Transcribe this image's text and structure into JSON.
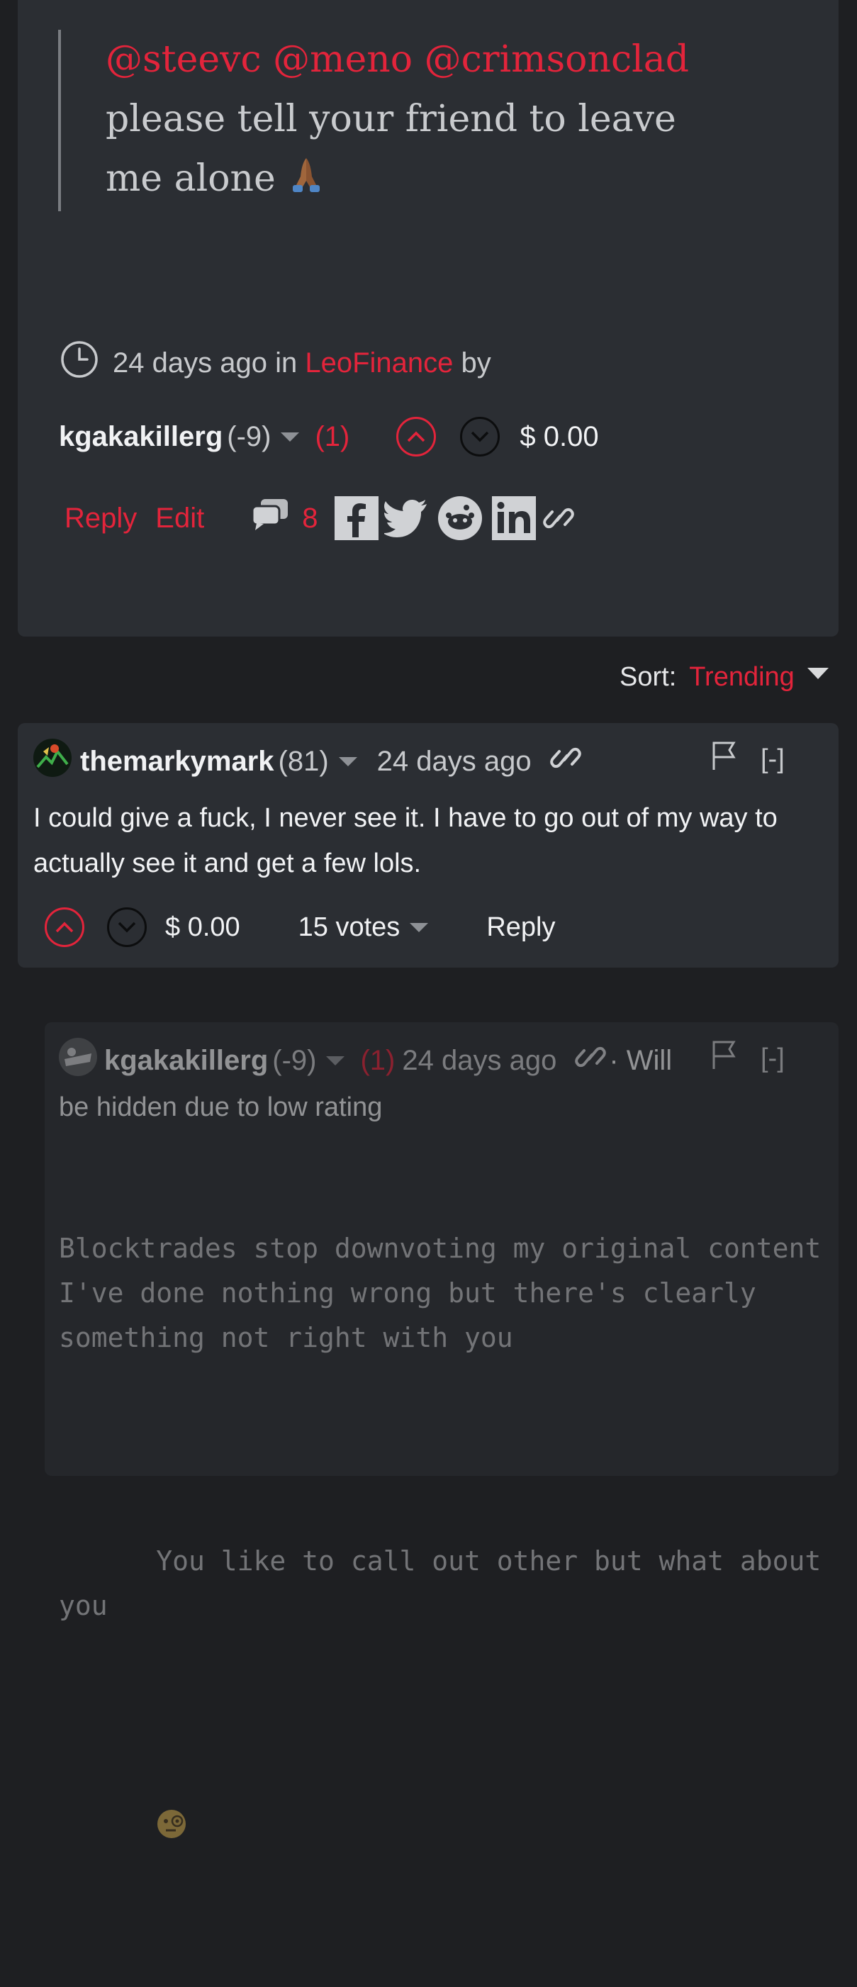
{
  "post": {
    "mentions": "@steevc @meno @crimsonclad",
    "body_text": "please tell your friend to leave me alone",
    "body_emoji": "🙏🏾",
    "meta_time": "24 days ago",
    "meta_in": "in",
    "community": "LeoFinance",
    "meta_by": "by",
    "author": "kgakakillerg",
    "author_rep": "(-9)",
    "flag_count": "(1)",
    "payout": "$ 0.00",
    "reply_label": "Reply",
    "edit_label": "Edit",
    "comments_count": "8",
    "share_icons": [
      "facebook-icon",
      "twitter-icon",
      "reddit-icon",
      "linkedin-icon",
      "link-icon"
    ]
  },
  "sort": {
    "label": "Sort:",
    "value": "Trending"
  },
  "comment_1": {
    "author": "themarkymark",
    "rep": "(81)",
    "time": "24 days ago",
    "collapse_label": "[-]",
    "body": "I could give a fuck, I never see it. I have to go out of my way to actually see it and get a few lols.",
    "payout": "$ 0.00",
    "votes": "15 votes",
    "reply_label": "Reply"
  },
  "comment_2": {
    "author": "kgakakillerg",
    "rep": "(-9)",
    "flag_count": "(1)",
    "time": "24 days ago",
    "hidden_note_1": "· Will",
    "hidden_note_2": "be hidden due to low rating",
    "collapse_label": "[-]",
    "body_p1": "Blocktrades stop downvoting my original content I've done nothing wrong but there's clearly something not right with you",
    "body_p2": "You like to call out other but what about you",
    "body_emoji": "🧐"
  },
  "colors": {
    "accent": "#e3243b",
    "card_bg": "#2b2e33",
    "page_bg": "#1e1f22"
  }
}
